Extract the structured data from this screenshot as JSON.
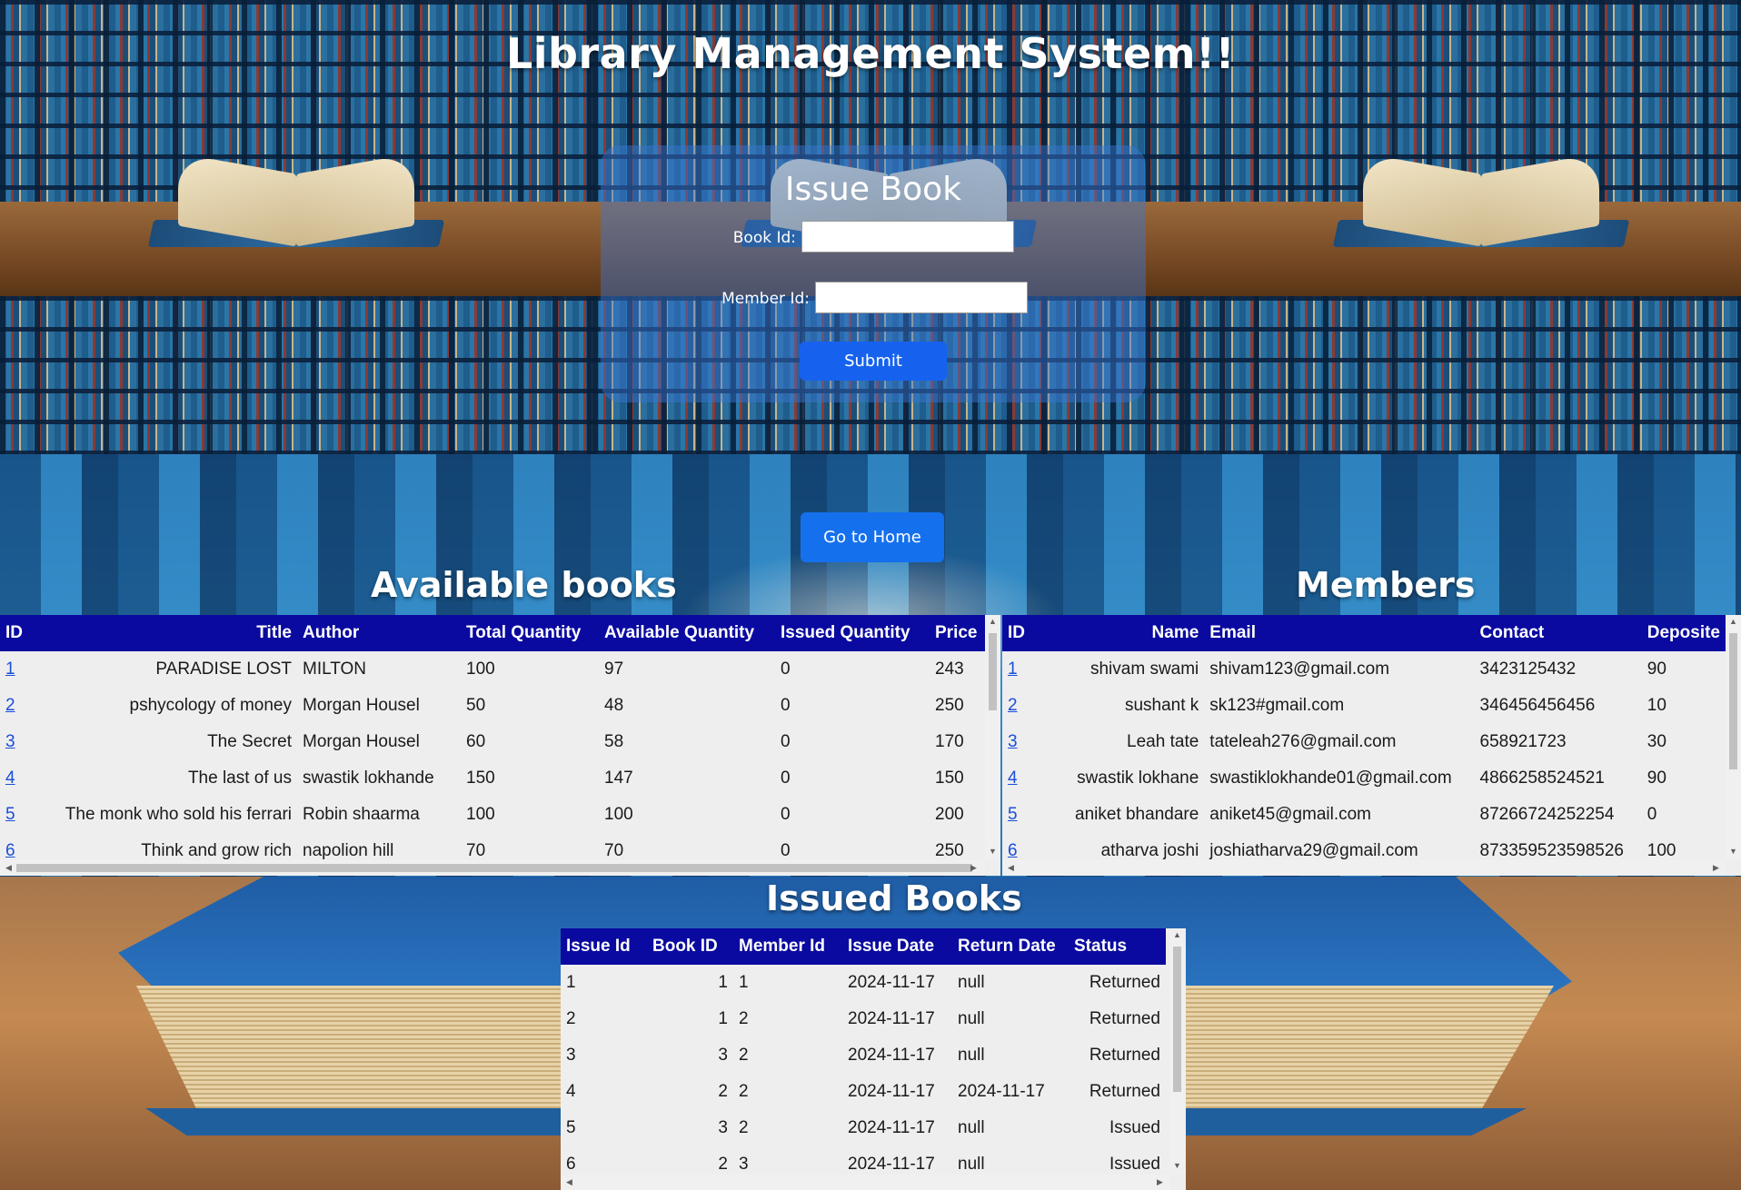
{
  "header": {
    "title": "Library Management System!!"
  },
  "issue_form": {
    "title": "Issue Book",
    "book_id_label": "Book Id:",
    "member_id_label": "Member Id:",
    "book_id_value": "",
    "member_id_value": "",
    "submit_label": "Submit"
  },
  "nav": {
    "home_label": "Go to Home"
  },
  "books": {
    "title": "Available books",
    "columns": [
      "ID",
      "Title",
      "Author",
      "Total Quantity",
      "Available Quantity",
      "Issued Quantity",
      "Price"
    ],
    "rows": [
      [
        "1",
        "PARADISE LOST",
        "MILTON",
        "100",
        "97",
        "0",
        "243"
      ],
      [
        "2",
        "pshycology of money",
        "Morgan Housel",
        "50",
        "48",
        "0",
        "250"
      ],
      [
        "3",
        "The Secret",
        "Morgan Housel",
        "60",
        "58",
        "0",
        "170"
      ],
      [
        "4",
        "The last of us",
        "swastik lokhande",
        "150",
        "147",
        "0",
        "150"
      ],
      [
        "5",
        "The monk who sold his ferrari",
        "Robin shaarma",
        "100",
        "100",
        "0",
        "200"
      ],
      [
        "6",
        "Think and grow rich",
        "napolion hill",
        "70",
        "70",
        "0",
        "250"
      ]
    ]
  },
  "members": {
    "title": "Members",
    "columns": [
      "ID",
      "Name",
      "Email",
      "Contact",
      "Deposite"
    ],
    "rows": [
      [
        "1",
        "shivam swami",
        "shivam123@gmail.com",
        "3423125432",
        "90"
      ],
      [
        "2",
        "sushant k",
        "sk123#gmail.com",
        "346456456456",
        "10"
      ],
      [
        "3",
        "Leah tate",
        "tateleah276@gmail.com",
        "658921723",
        "30"
      ],
      [
        "4",
        "swastik lokhane",
        "swastiklokhande01@gmail.com",
        "4866258524521",
        "90"
      ],
      [
        "5",
        "aniket bhandare",
        "aniket45@gmail.com",
        "87266724252254",
        "0"
      ],
      [
        "6",
        "atharva joshi",
        "joshiatharva29@gmail.com",
        "873359523598526",
        "100"
      ]
    ]
  },
  "issued": {
    "title": "Issued Books",
    "columns": [
      "Issue Id",
      "Book ID",
      "Member Id",
      "Issue Date",
      "Return Date",
      "Status"
    ],
    "rows": [
      [
        "1",
        "1",
        "1",
        "2024-11-17",
        "null",
        "Returned"
      ],
      [
        "2",
        "1",
        "2",
        "2024-11-17",
        "null",
        "Returned"
      ],
      [
        "3",
        "3",
        "2",
        "2024-11-17",
        "null",
        "Returned"
      ],
      [
        "4",
        "2",
        "2",
        "2024-11-17",
        "2024-11-17",
        "Returned"
      ],
      [
        "5",
        "3",
        "2",
        "2024-11-17",
        "null",
        "Issued"
      ],
      [
        "6",
        "2",
        "3",
        "2024-11-17",
        "null",
        "Issued"
      ]
    ]
  },
  "colors": {
    "table_header": "#0a0aa0",
    "button": "#1662ee",
    "link": "#1a4fd8"
  }
}
